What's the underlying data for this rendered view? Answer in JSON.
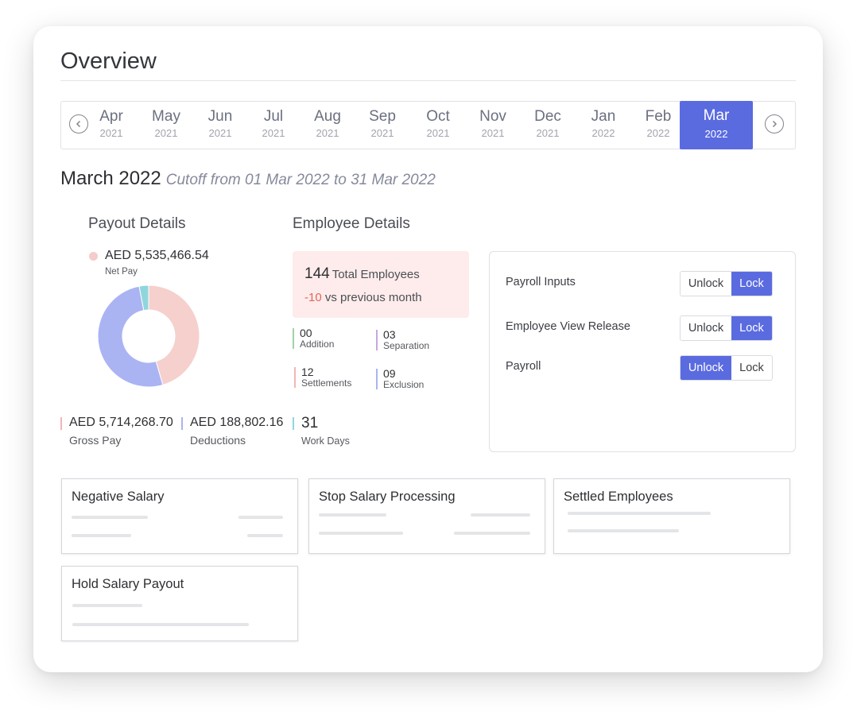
{
  "overview_title": "Overview",
  "months": [
    {
      "month": "Apr",
      "year": "2021"
    },
    {
      "month": "May",
      "year": "2021"
    },
    {
      "month": "Jun",
      "year": "2021"
    },
    {
      "month": "Jul",
      "year": "2021"
    },
    {
      "month": "Aug",
      "year": "2021"
    },
    {
      "month": "Sep",
      "year": "2021"
    },
    {
      "month": "Oct",
      "year": "2021"
    },
    {
      "month": "Nov",
      "year": "2021"
    },
    {
      "month": "Dec",
      "year": "2021"
    },
    {
      "month": "Jan",
      "year": "2022"
    },
    {
      "month": "Feb",
      "year": "2022"
    },
    {
      "month": "Mar",
      "year": "2022",
      "selected": true
    }
  ],
  "period": {
    "title": "March 2022",
    "cutoff": "Cutoff from 01 Mar 2022 to 31 Mar 2022"
  },
  "payout": {
    "heading": "Payout Details",
    "net_pay_amount": "AED 5,535,466.54",
    "net_pay_label": "Net Pay",
    "donut_segments": [
      {
        "name": "Net Pay",
        "share": 0.455,
        "color": "#f5d0cc"
      },
      {
        "name": "Gross Pay",
        "share": 0.515,
        "color": "#aab4f3"
      },
      {
        "name": "Deductions",
        "share": 0.03,
        "color": "#8fd6dc"
      }
    ],
    "gross_amount": "AED 5,714,268.70",
    "gross_label": "Gross Pay",
    "deductions_amount": "AED 188,802.16",
    "deductions_label": "Deductions",
    "work_days": "31",
    "work_days_label": "Work Days"
  },
  "employee": {
    "heading": "Employee Details",
    "total": "144",
    "total_label": "Total Employees",
    "delta": "-10",
    "delta_label": "vs previous month",
    "stats": [
      {
        "value": "00",
        "label": "Addition",
        "color": "#9ed4a8"
      },
      {
        "value": "03",
        "label": "Separation",
        "color": "#c8a6e0"
      },
      {
        "value": "12",
        "label": "Settlements",
        "color": "#f2b6b6"
      },
      {
        "value": "09",
        "label": "Exclusion",
        "color": "#a9b5ee"
      }
    ]
  },
  "locks": [
    {
      "label": "Payroll Inputs",
      "unlock": "Unlock",
      "lock": "Lock",
      "state": "lock"
    },
    {
      "label": "Employee View Release",
      "unlock": "Unlock",
      "lock": "Lock",
      "state": "lock"
    },
    {
      "label": "Payroll",
      "unlock": "Unlock",
      "lock": "Lock",
      "state": "unlock"
    }
  ],
  "tiles": [
    {
      "title": "Negative Salary"
    },
    {
      "title": "Stop Salary Processing"
    },
    {
      "title": "Settled Employees"
    },
    {
      "title": "Hold Salary Payout"
    }
  ],
  "colors": {
    "accent": "#5a6be0",
    "gross_bar": "#f2b6b6",
    "deductions_bar": "#a9b5ee",
    "workdays_bar": "#8fd6dc"
  }
}
